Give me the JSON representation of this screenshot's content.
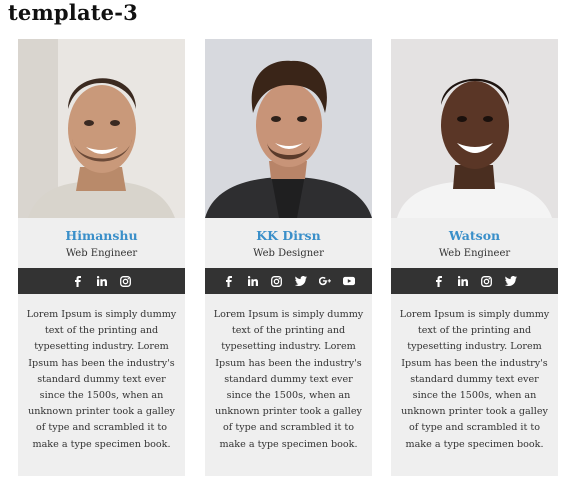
{
  "page": {
    "title": "template-3"
  },
  "colors": {
    "name": "#3a8fc9",
    "social_bar": "#333333",
    "card_bg": "#efefef"
  },
  "cards": [
    {
      "name": "Himanshu",
      "role": "Web Engineer",
      "social": [
        "facebook-icon",
        "linkedin-icon",
        "instagram-icon"
      ],
      "bio": "Lorem Ipsum is simply dummy text of the printing and typesetting industry. Lorem Ipsum has been the industry's standard dummy text ever since the 1500s, when an unknown printer took a galley of type and scrambled it to make a type specimen book."
    },
    {
      "name": "KK Dirsn",
      "role": "Web Designer",
      "social": [
        "facebook-icon",
        "linkedin-icon",
        "instagram-icon",
        "twitter-icon",
        "google-plus-icon",
        "youtube-icon"
      ],
      "bio": "Lorem Ipsum is simply dummy text of the printing and typesetting industry. Lorem Ipsum has been the industry's standard dummy text ever since the 1500s, when an unknown printer took a galley of type and scrambled it to make a type specimen book."
    },
    {
      "name": "Watson",
      "role": "Web Engineer",
      "social": [
        "facebook-icon",
        "linkedin-icon",
        "instagram-icon",
        "twitter-icon"
      ],
      "bio": "Lorem Ipsum is simply dummy text of the printing and typesetting industry. Lorem Ipsum has been the industry's standard dummy text ever since the 1500s, when an unknown printer took a galley of type and scrambled it to make a type specimen book."
    }
  ]
}
